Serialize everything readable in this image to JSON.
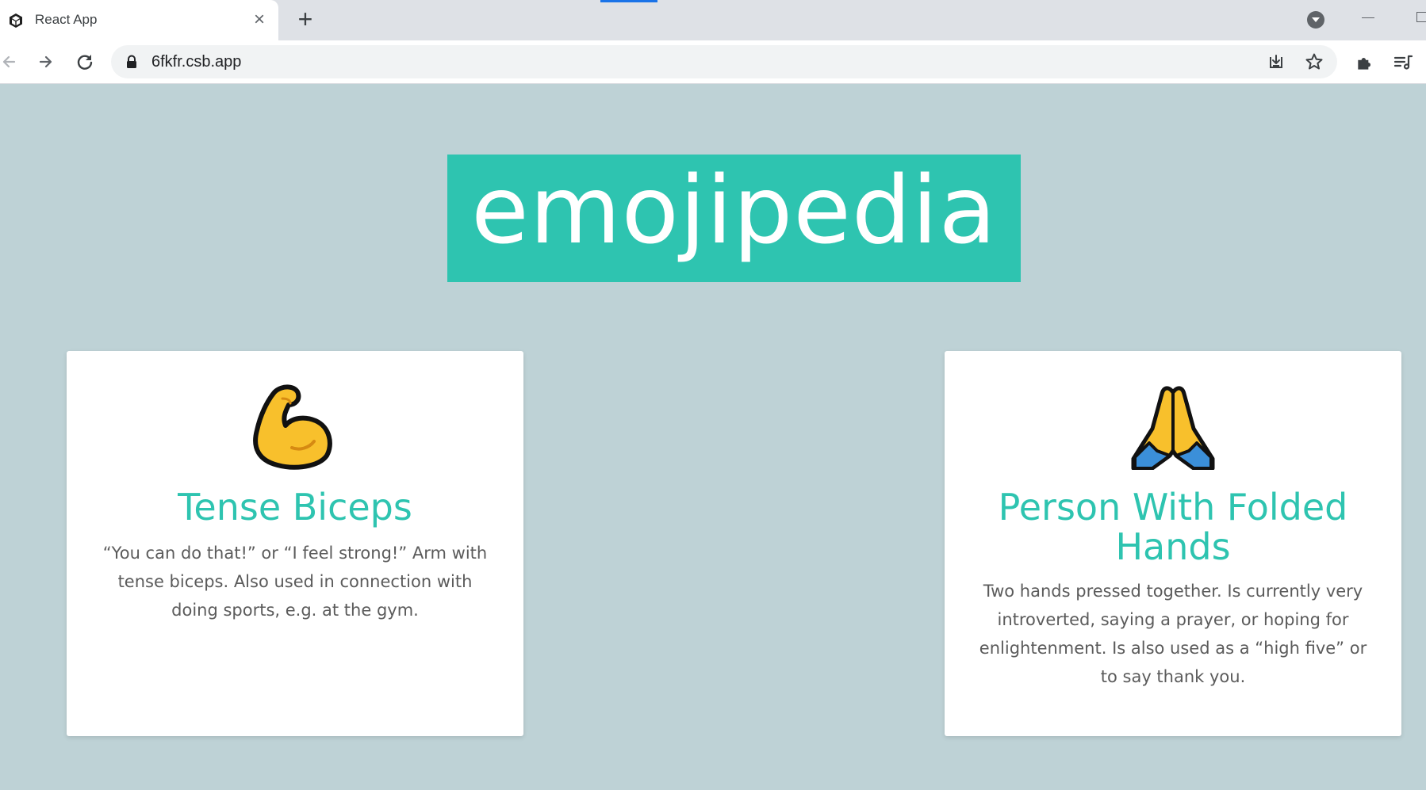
{
  "browser": {
    "tab": {
      "title": "React App",
      "favicon": "codesandbox-cube-icon",
      "close_icon": "close-icon"
    },
    "new_tab_icon": "plus-icon",
    "address_bar": {
      "url": "6fkfr.csb.app",
      "lock_icon": "lock-icon"
    },
    "toolbar_icons": [
      "back-icon",
      "forward-icon",
      "reload-icon",
      "install-app-icon",
      "bookmark-star-icon",
      "extensions-icon",
      "reading-list-icon"
    ]
  },
  "page": {
    "logo": "emojipedia",
    "cards": [
      {
        "emoji": "flexed-biceps-icon",
        "name": "Tense Biceps",
        "description": "“You can do that!” or “I feel strong!” Arm with tense biceps. Also used in connection with doing sports, e.g. at the gym."
      },
      {
        "emoji": "folded-hands-icon",
        "name": "Person With Folded Hands",
        "description": "Two hands pressed together. Is currently very introverted, saying a prayer, or hoping for enlightenment. Is also used as a “high five” or to say thank you."
      }
    ]
  },
  "colors": {
    "background": "#bed2d6",
    "accent": "#2ec4b0",
    "card": "#ffffff",
    "text": "#5b5b5b"
  }
}
